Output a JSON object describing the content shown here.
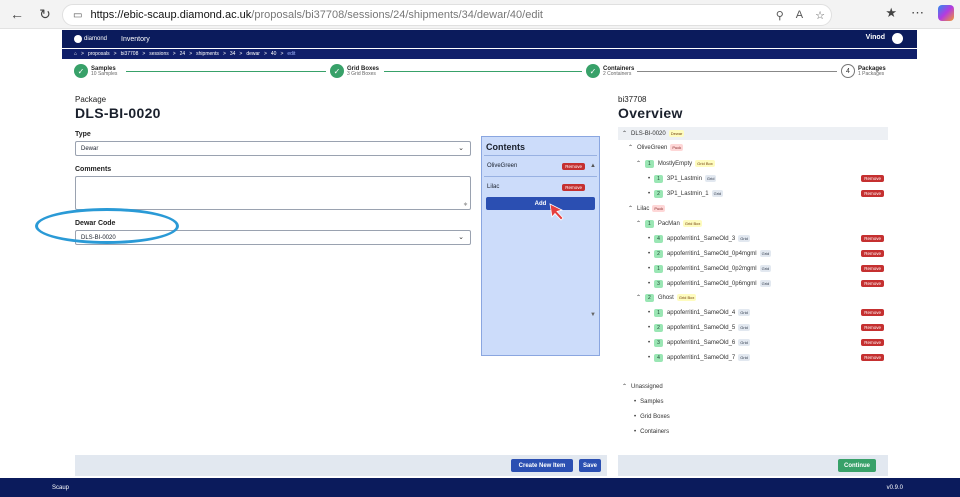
{
  "browser": {
    "url_host": "https://ebic-scaup.diamond.ac.uk",
    "url_path": "/proposals/bi37708/sessions/24/shipments/34/dewar/40/edit"
  },
  "topbar": {
    "logo": "diamond",
    "menu_inventory": "Inventory",
    "user": "Vinod"
  },
  "breadcrumb": [
    "proposals",
    "bi37708",
    "sessions",
    "24",
    "shipments",
    "34",
    "dewar",
    "40",
    "edit"
  ],
  "stepper": [
    {
      "title": "Samples",
      "sub": "10 Samples",
      "done": true
    },
    {
      "title": "Grid Boxes",
      "sub": "3 Grid Boxes",
      "done": true
    },
    {
      "title": "Containers",
      "sub": "2 Containers",
      "done": true
    },
    {
      "title": "Packages",
      "sub": "1 Packages",
      "done": false,
      "index": "4"
    }
  ],
  "form": {
    "package_label": "Package",
    "package_name": "DLS-BI-0020",
    "type_label": "Type",
    "type_value": "Dewar",
    "comments_label": "Comments",
    "dewar_code_label": "Dewar Code",
    "dewar_code_value": "DLS-BI-0020"
  },
  "contents": {
    "title": "Contents",
    "items": [
      {
        "name": "OliveGreen",
        "remove": "Remove"
      },
      {
        "name": "Lilac",
        "remove": "Remove"
      }
    ],
    "add": "Add"
  },
  "footer": {
    "create_new": "Create New Item",
    "save": "Save",
    "continue": "Continue"
  },
  "overview": {
    "proposal": "bi37708",
    "title": "Overview",
    "root": {
      "name": "DLS-BI-0020",
      "tag": "Dewar"
    },
    "puck1": {
      "name": "OliveGreen",
      "tag": "Puck"
    },
    "box1": {
      "num": "1",
      "name": "MostlyEmpty",
      "tag": "Grid Box"
    },
    "box1_items": [
      {
        "num": "1",
        "name": "3P1_Lastmin",
        "tag": "Grid"
      },
      {
        "num": "2",
        "name": "3P1_Lastmin_1",
        "tag": "Grid"
      }
    ],
    "puck2": {
      "name": "Lilac",
      "tag": "Puck"
    },
    "box2": {
      "num": "1",
      "name": "PacMan",
      "tag": "Grid Box"
    },
    "box2_items": [
      {
        "num": "4",
        "name": "appoferritin1_SameOld_3",
        "tag": "Grid"
      },
      {
        "num": "2",
        "name": "appoferritin1_SameOld_0p4mgml",
        "tag": "Grid"
      },
      {
        "num": "1",
        "name": "appoferritin1_SameOld_0p2mgml",
        "tag": "Grid"
      },
      {
        "num": "3",
        "name": "appoferritin1_SameOld_0p6mgml",
        "tag": "Grid"
      }
    ],
    "box3": {
      "num": "2",
      "name": "Ghost",
      "tag": "Grid Box"
    },
    "box3_items": [
      {
        "num": "1",
        "name": "appoferritin1_SameOld_4",
        "tag": "Grid"
      },
      {
        "num": "2",
        "name": "appoferritin1_SameOld_5",
        "tag": "Grid"
      },
      {
        "num": "3",
        "name": "appoferritin1_SameOld_6",
        "tag": "Grid"
      },
      {
        "num": "4",
        "name": "appoferritin1_SameOld_7",
        "tag": "Grid"
      }
    ],
    "remove": "Remove",
    "unassigned": "Unassigned",
    "unassigned_items": [
      "Samples",
      "Grid Boxes",
      "Containers"
    ]
  },
  "bottom": {
    "app": "Scaup",
    "version": "v0.9.0"
  },
  "colors": {
    "navy": "#0b1b5c",
    "primary": "#2b4fb2",
    "success": "#38a169",
    "danger": "#c53030",
    "highlight": "#2a9ad6"
  }
}
